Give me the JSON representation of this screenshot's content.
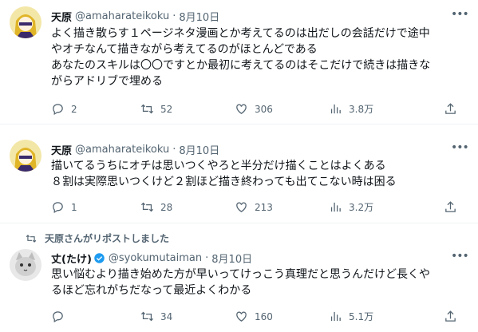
{
  "tweets": [
    {
      "name": "天原",
      "handle": "@amaharateikoku",
      "date": "8月10日",
      "text": "よく描き散らす１ページネタ漫画とか考えてるのは出だしの会話だけで途中\nやオチなんて描きながら考えてるのがほとんどである\nあなたのスキルは〇〇ですとか最初に考えてるのはそこだけで続きは描きな\nがらアドリブで埋める",
      "replies": "2",
      "retweets": "52",
      "likes": "306",
      "views": "3.8万"
    },
    {
      "name": "天原",
      "handle": "@amaharateikoku",
      "date": "8月10日",
      "text": "描いてるうちにオチは思いつくやろと半分だけ描くことはよくある\n８割は実際思いつくけど２割ほど描き終わっても出てこない時は困る",
      "replies": "1",
      "retweets": "28",
      "likes": "213",
      "views": "3.2万"
    },
    {
      "retweet_note": "天原さんがリポストしました",
      "name": "丈(たけ)",
      "handle": "@syokumutaiman",
      "date": "8月10日",
      "text": "思い悩むより描き始めた方が早いってけっこう真理だと思うんだけど長くや\nるほど忘れがちだなって最近よくわかる",
      "replies": "",
      "retweets": "34",
      "likes": "160",
      "views": "5.1万"
    }
  ],
  "separator": "·",
  "more_label": "•••",
  "colors": {
    "text": "#0f1419",
    "secondary": "#536471",
    "verified": "#1d9bf0",
    "divider": "#eff3f4"
  },
  "icons": [
    "reply-icon",
    "retweet-icon",
    "like-icon",
    "views-icon",
    "share-icon",
    "more-icon",
    "verified-icon"
  ]
}
